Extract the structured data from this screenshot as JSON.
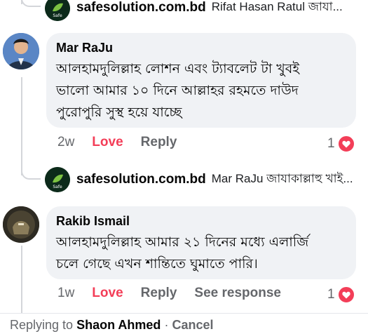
{
  "reply_top": {
    "page": "safesolution.com.bd",
    "snippet": "Rifat Hasan Ratul জাযা..."
  },
  "comments": [
    {
      "author": "Mar RaJu",
      "text_line1": "আলহামদুলিল্লাহ লোশন এবং ট্যাবলেট টা খুবই",
      "text_line2": "ভালো আমার ১০ দিনে আল্লাহর রহমতে দাউদ",
      "text_line3": "পুরোপুরি সুস্থ হয়ে যাচ্ছে",
      "time": "2w",
      "love_label": "Love",
      "reply_label": "Reply",
      "reaction_count": "1"
    },
    {
      "author": "Rakib Ismail",
      "text_line1": "আলহামদুলিল্লাহ আমার ২১ দিনের মধ্যে এলার্জি",
      "text_line2": "চলে গেছে এখন শান্তিতে ঘুমাতে পারি।",
      "time": "1w",
      "love_label": "Love",
      "reply_label": "Reply",
      "see_response_label": "See response",
      "reaction_count": "1"
    }
  ],
  "reply_middle": {
    "page": "safesolution.com.bd",
    "snippet": "Mar RaJu জাযাকাল্লাহু খাই..."
  },
  "replying_bar": {
    "prefix": "Replying to",
    "name": "Shaon Ahmed",
    "separator": "·",
    "cancel": "Cancel"
  },
  "colors": {
    "love": "#f33e58",
    "bubble": "#f0f2f5",
    "muted": "#65676b"
  }
}
